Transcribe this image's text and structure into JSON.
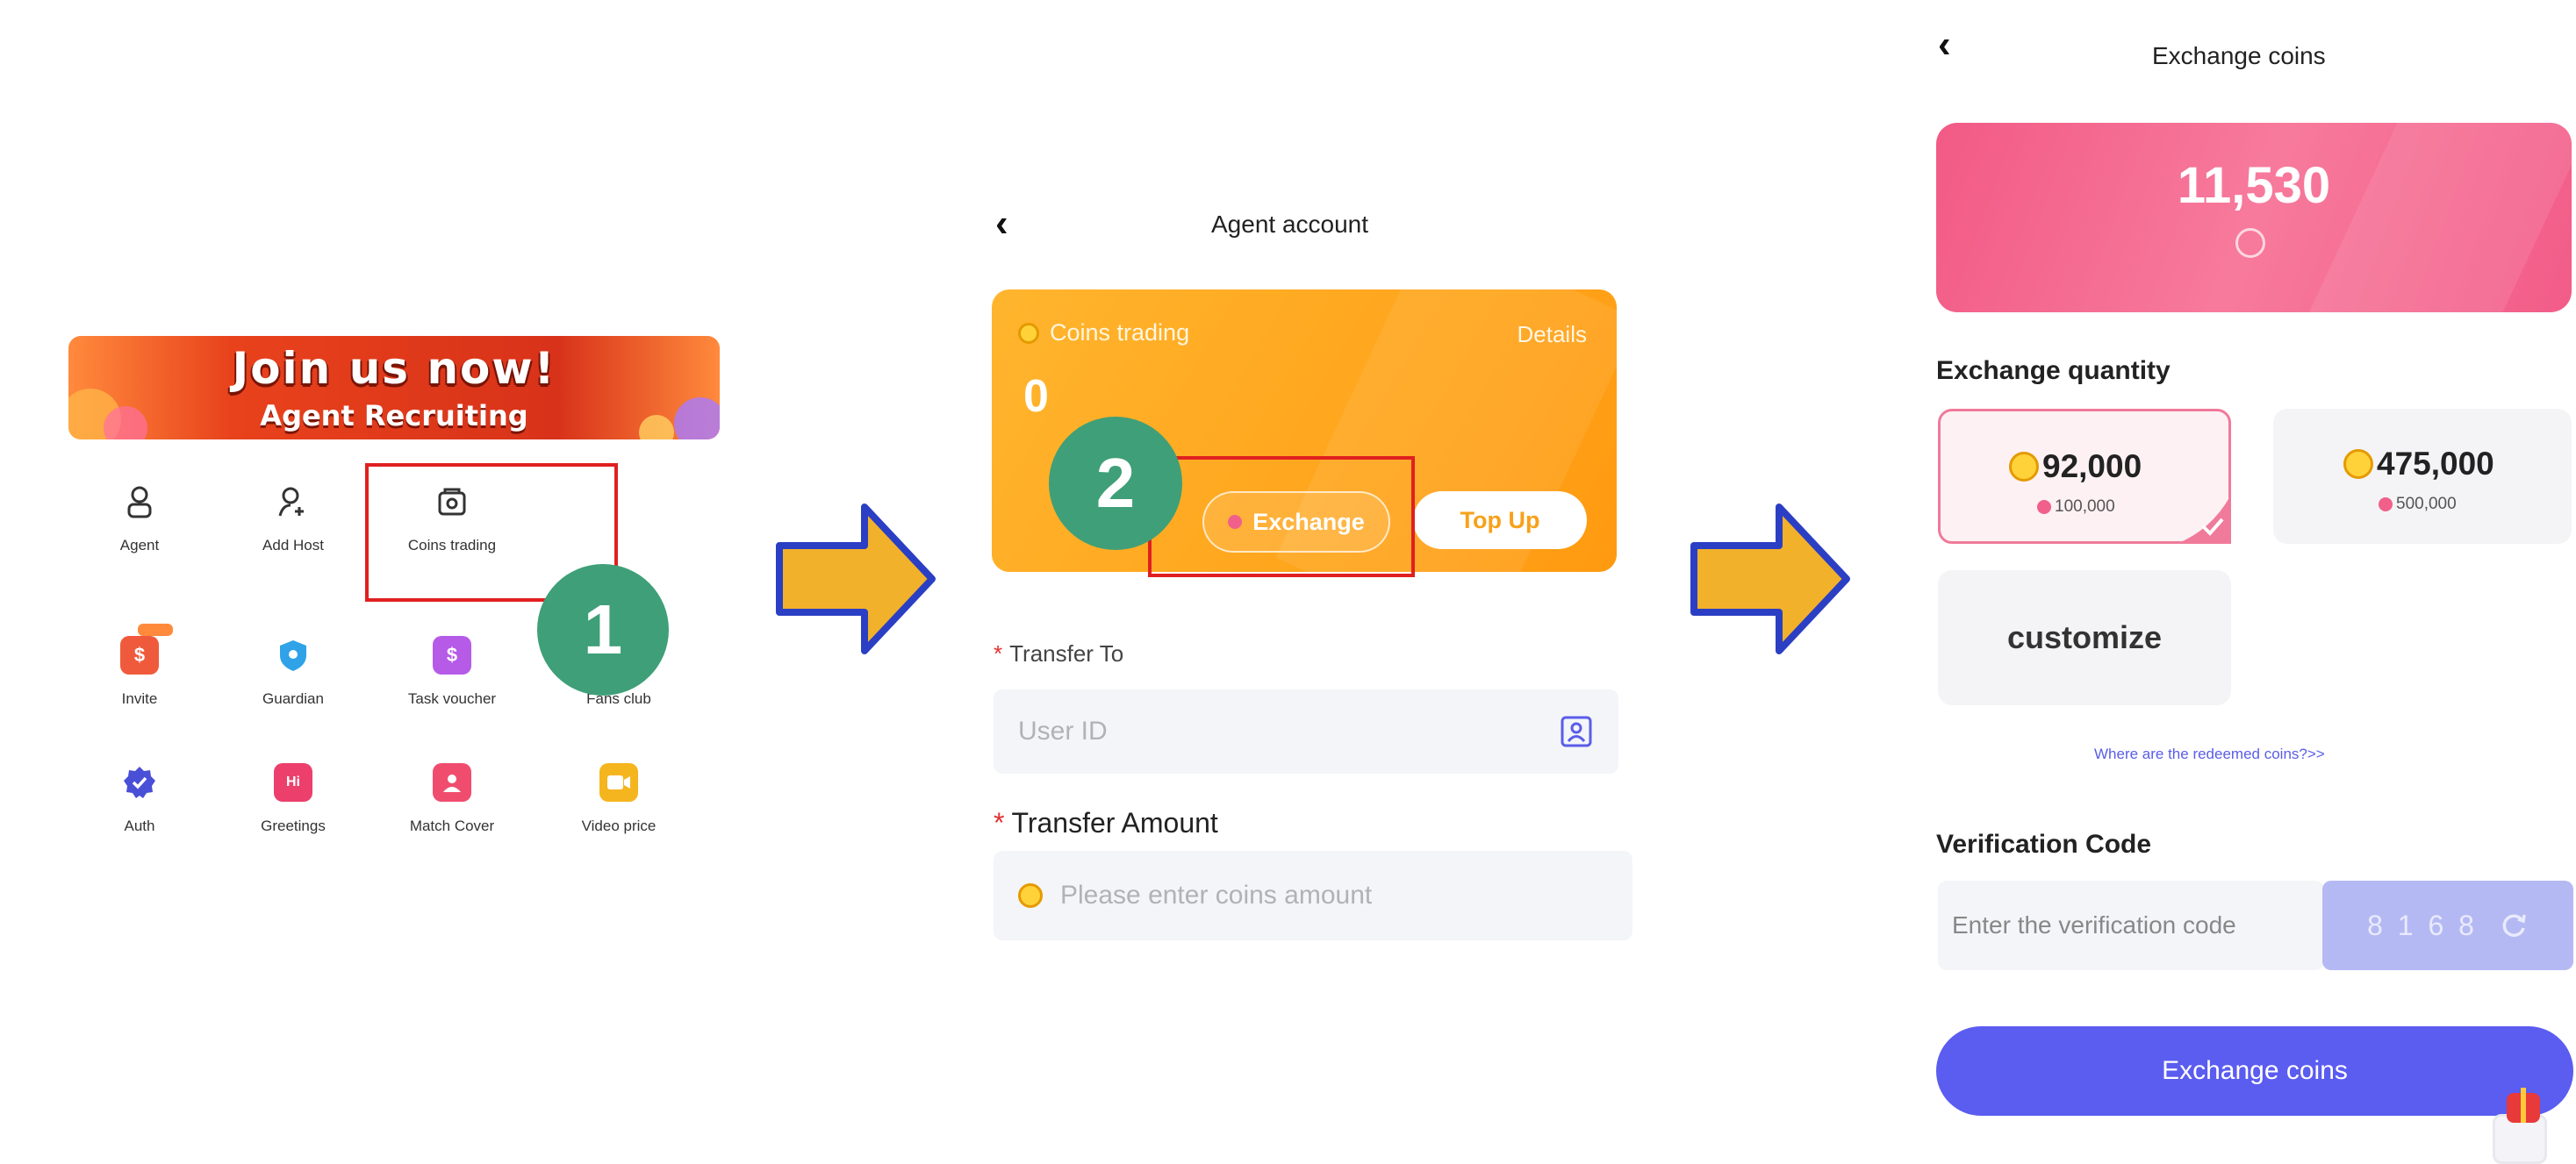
{
  "panel1": {
    "banner": {
      "title": "Join us now!",
      "subtitle": "Agent Recruiting"
    },
    "grid": [
      {
        "label": "Agent",
        "icon": "agent-icon"
      },
      {
        "label": "Add Host",
        "icon": "add-host-icon"
      },
      {
        "label": "Coins trading",
        "icon": "coins-trading-icon"
      },
      {
        "label": "Invite",
        "icon": "invite-icon"
      },
      {
        "label": "Guardian",
        "icon": "guardian-shield-icon"
      },
      {
        "label": "Task voucher",
        "icon": "task-voucher-icon"
      },
      {
        "label": "Fans club",
        "icon": "fans-club-icon"
      },
      {
        "label": "Auth",
        "icon": "auth-badge-icon"
      },
      {
        "label": "Greetings",
        "icon": "greetings-icon"
      },
      {
        "label": "Match Cover",
        "icon": "match-cover-icon"
      },
      {
        "label": "Video price",
        "icon": "video-price-icon"
      }
    ],
    "step": "1"
  },
  "panel2": {
    "title": "Agent account",
    "card": {
      "label": "Coins trading",
      "details": "Details",
      "balance": "0",
      "exchange": "Exchange",
      "topup": "Top Up"
    },
    "step": "2",
    "transfer_to": {
      "label": "Transfer To",
      "placeholder": "User ID"
    },
    "transfer_amount": {
      "label": "Transfer Amount",
      "placeholder": "Please enter coins amount"
    }
  },
  "panel3": {
    "title": "Exchange coins",
    "balance": "11,530",
    "quantity_title": "Exchange quantity",
    "options": [
      {
        "coins": "92,000",
        "cost": "100,000",
        "selected": true
      },
      {
        "coins": "475,000",
        "cost": "500,000",
        "selected": false
      }
    ],
    "customize": "customize",
    "help_link": "Where are the redeemed coins?>>",
    "verification": {
      "title": "Verification Code",
      "placeholder": "Enter the verification code",
      "captcha": "8 1 6 8"
    },
    "submit": "Exchange coins"
  },
  "colors": {
    "highlight_red": "#e02020",
    "step_green": "#3f9f78",
    "arrow_yellow": "#f2b12a",
    "arrow_blue": "#2b3fc4",
    "orange_card": "#ffa51c",
    "pink_card": "#f25a86",
    "primary_button": "#5b5cf0"
  }
}
